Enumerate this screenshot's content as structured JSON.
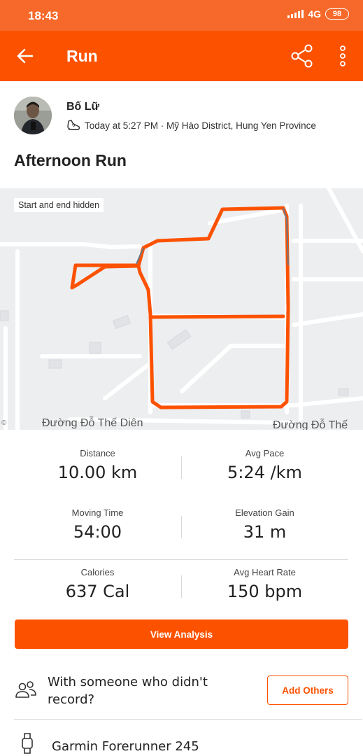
{
  "status_bar": {
    "time": "18:43",
    "network": "4G",
    "battery": "98"
  },
  "app_bar": {
    "title": "Run",
    "back_icon": "arrow-left-icon",
    "share_icon": "share-icon",
    "more_icon": "more-vertical-icon"
  },
  "athlete": {
    "name": "Bố Lữ",
    "meta": "Today at 5:27 PM · Mỹ Hào District, Hung Yen Province",
    "activity_icon": "shoe-icon"
  },
  "activity": {
    "title": "Afternoon Run"
  },
  "map": {
    "badge": "Start and end hidden",
    "street_left": "Đường Đỗ Thế Diên",
    "street_right": "Đường Đỗ Thế",
    "route_color": "#fc5200"
  },
  "stats": [
    {
      "label": "Distance",
      "value": "10.00 km"
    },
    {
      "label": "Avg Pace",
      "value": "5:24 /km"
    },
    {
      "label": "Moving Time",
      "value": "54:00"
    },
    {
      "label": "Elevation Gain",
      "value": "31 m"
    },
    {
      "label": "Calories",
      "value": "637 Cal"
    },
    {
      "label": "Avg Heart Rate",
      "value": "150 bpm"
    }
  ],
  "actions": {
    "view_analysis": "View Analysis",
    "with_someone": "With someone who didn't record?",
    "add_others": "Add Others"
  },
  "device": {
    "name": "Garmin Forerunner 245",
    "icon": "watch-icon"
  },
  "colors": {
    "brand": "#fc5200",
    "status_bar": "#f6692a"
  }
}
